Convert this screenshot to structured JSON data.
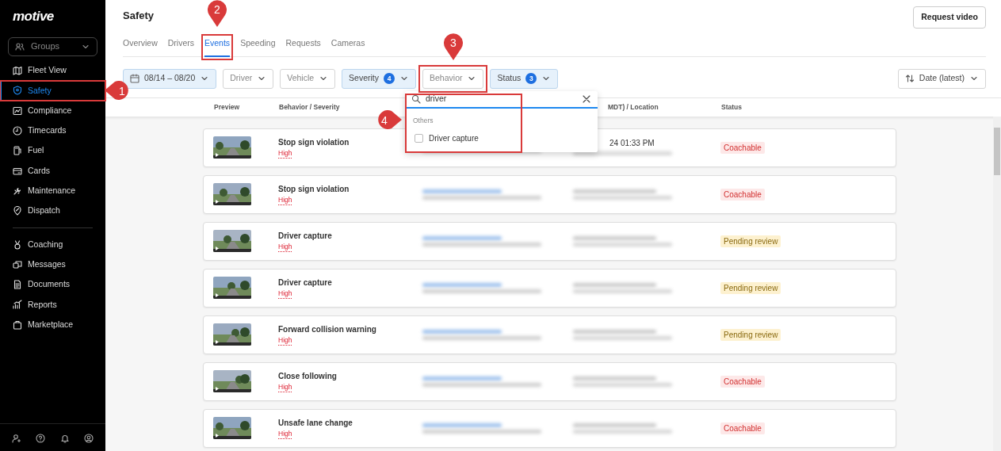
{
  "sidebar": {
    "logo": "motive",
    "groups_selector": "Groups",
    "sections": [
      [
        {
          "label": "Fleet View",
          "selected": false
        },
        {
          "label": "Safety",
          "selected": true
        },
        {
          "label": "Compliance",
          "selected": false
        },
        {
          "label": "Timecards",
          "selected": false
        },
        {
          "label": "Fuel",
          "selected": false
        },
        {
          "label": "Cards",
          "selected": false
        },
        {
          "label": "Maintenance",
          "selected": false
        },
        {
          "label": "Dispatch",
          "selected": false
        }
      ],
      [
        {
          "label": "Coaching",
          "selected": false
        },
        {
          "label": "Messages",
          "selected": false
        },
        {
          "label": "Documents",
          "selected": false
        },
        {
          "label": "Reports",
          "selected": false
        },
        {
          "label": "Marketplace",
          "selected": false
        }
      ]
    ]
  },
  "header": {
    "title": "Safety",
    "button": "Request video"
  },
  "tabs": [
    {
      "label": "Overview",
      "selected": false
    },
    {
      "label": "Drivers",
      "selected": false
    },
    {
      "label": "Events",
      "selected": true
    },
    {
      "label": "Speeding",
      "selected": false
    },
    {
      "label": "Requests",
      "selected": false
    },
    {
      "label": "Cameras",
      "selected": false
    }
  ],
  "filters": [
    {
      "kind": "date",
      "label": "08/14 – 08/20",
      "applied": true
    },
    {
      "kind": "plain",
      "label": "Driver",
      "applied": false
    },
    {
      "kind": "plain",
      "label": "Vehicle",
      "applied": false
    },
    {
      "kind": "count",
      "label": "Severity",
      "count": "4",
      "applied": true
    },
    {
      "kind": "plain",
      "label": "Behavior",
      "applied": false
    },
    {
      "kind": "count",
      "label": "Status",
      "count": "3",
      "applied": true
    }
  ],
  "sort": "Date (latest)",
  "table": {
    "columns": [
      "Preview",
      "Behavior / Severity",
      "MDT) / Location",
      "Status"
    ],
    "rows": [
      {
        "behavior": "Stop sign violation",
        "severity": "High",
        "time": "24 01:33 PM",
        "status": "Coachable",
        "color": "#fde8e8"
      },
      {
        "behavior": "Stop sign violation",
        "severity": "High",
        "status": "Coachable",
        "color": "#fde8e8"
      },
      {
        "behavior": "Driver capture",
        "severity": "High",
        "status": "Pending review",
        "color": "#fdf1cf"
      },
      {
        "behavior": "Driver capture",
        "severity": "High",
        "status": "Pending review",
        "color": "#fdf1cf"
      },
      {
        "behavior": "Forward collision warning",
        "severity": "High",
        "status": "Pending review",
        "color": "#fdf1cf"
      },
      {
        "behavior": "Close following",
        "severity": "High",
        "status": "Coachable",
        "color": "#fde8e8"
      },
      {
        "behavior": "Unsafe lane change",
        "severity": "High",
        "status": "Coachable",
        "color": "#fde8e8"
      }
    ]
  },
  "behavior_dropdown": {
    "search_value": "driver",
    "group_label": "Others",
    "options": [
      {
        "label": "Driver capture",
        "checked": false
      }
    ]
  },
  "annotations": [
    {
      "number": "1"
    },
    {
      "number": "2"
    },
    {
      "number": "3"
    },
    {
      "number": "4"
    }
  ]
}
